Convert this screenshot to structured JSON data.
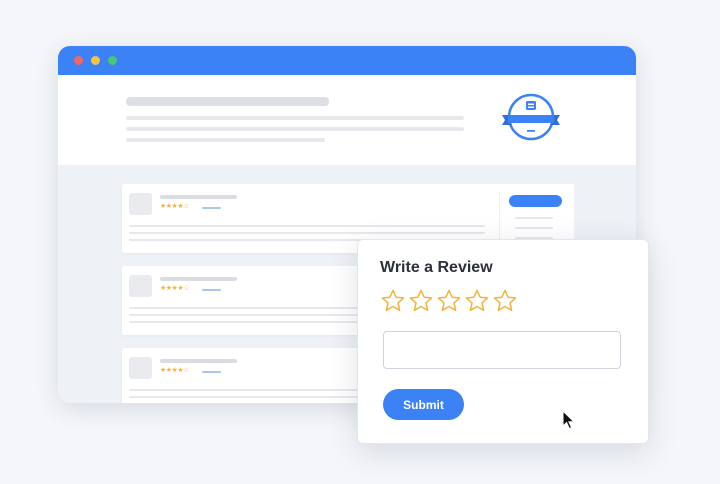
{
  "browser": {
    "window_controls": [
      "close",
      "minimize",
      "maximize"
    ],
    "accent_color": "#3b82f6",
    "badge_icon": "award-badge-icon"
  },
  "reviews": {
    "items": [
      {
        "rating": 4,
        "stars": "★★★★☆"
      },
      {
        "rating": 4,
        "stars": "★★★★☆"
      },
      {
        "rating": 4,
        "stars": "★★★★☆"
      }
    ]
  },
  "review_modal": {
    "title": "Write a Review",
    "star_count": 5,
    "selected_rating": 0,
    "input_value": "",
    "submit_label": "Submit",
    "star_color": "#f2b33d"
  },
  "cursor": {
    "icon": "mouse-pointer-icon"
  }
}
